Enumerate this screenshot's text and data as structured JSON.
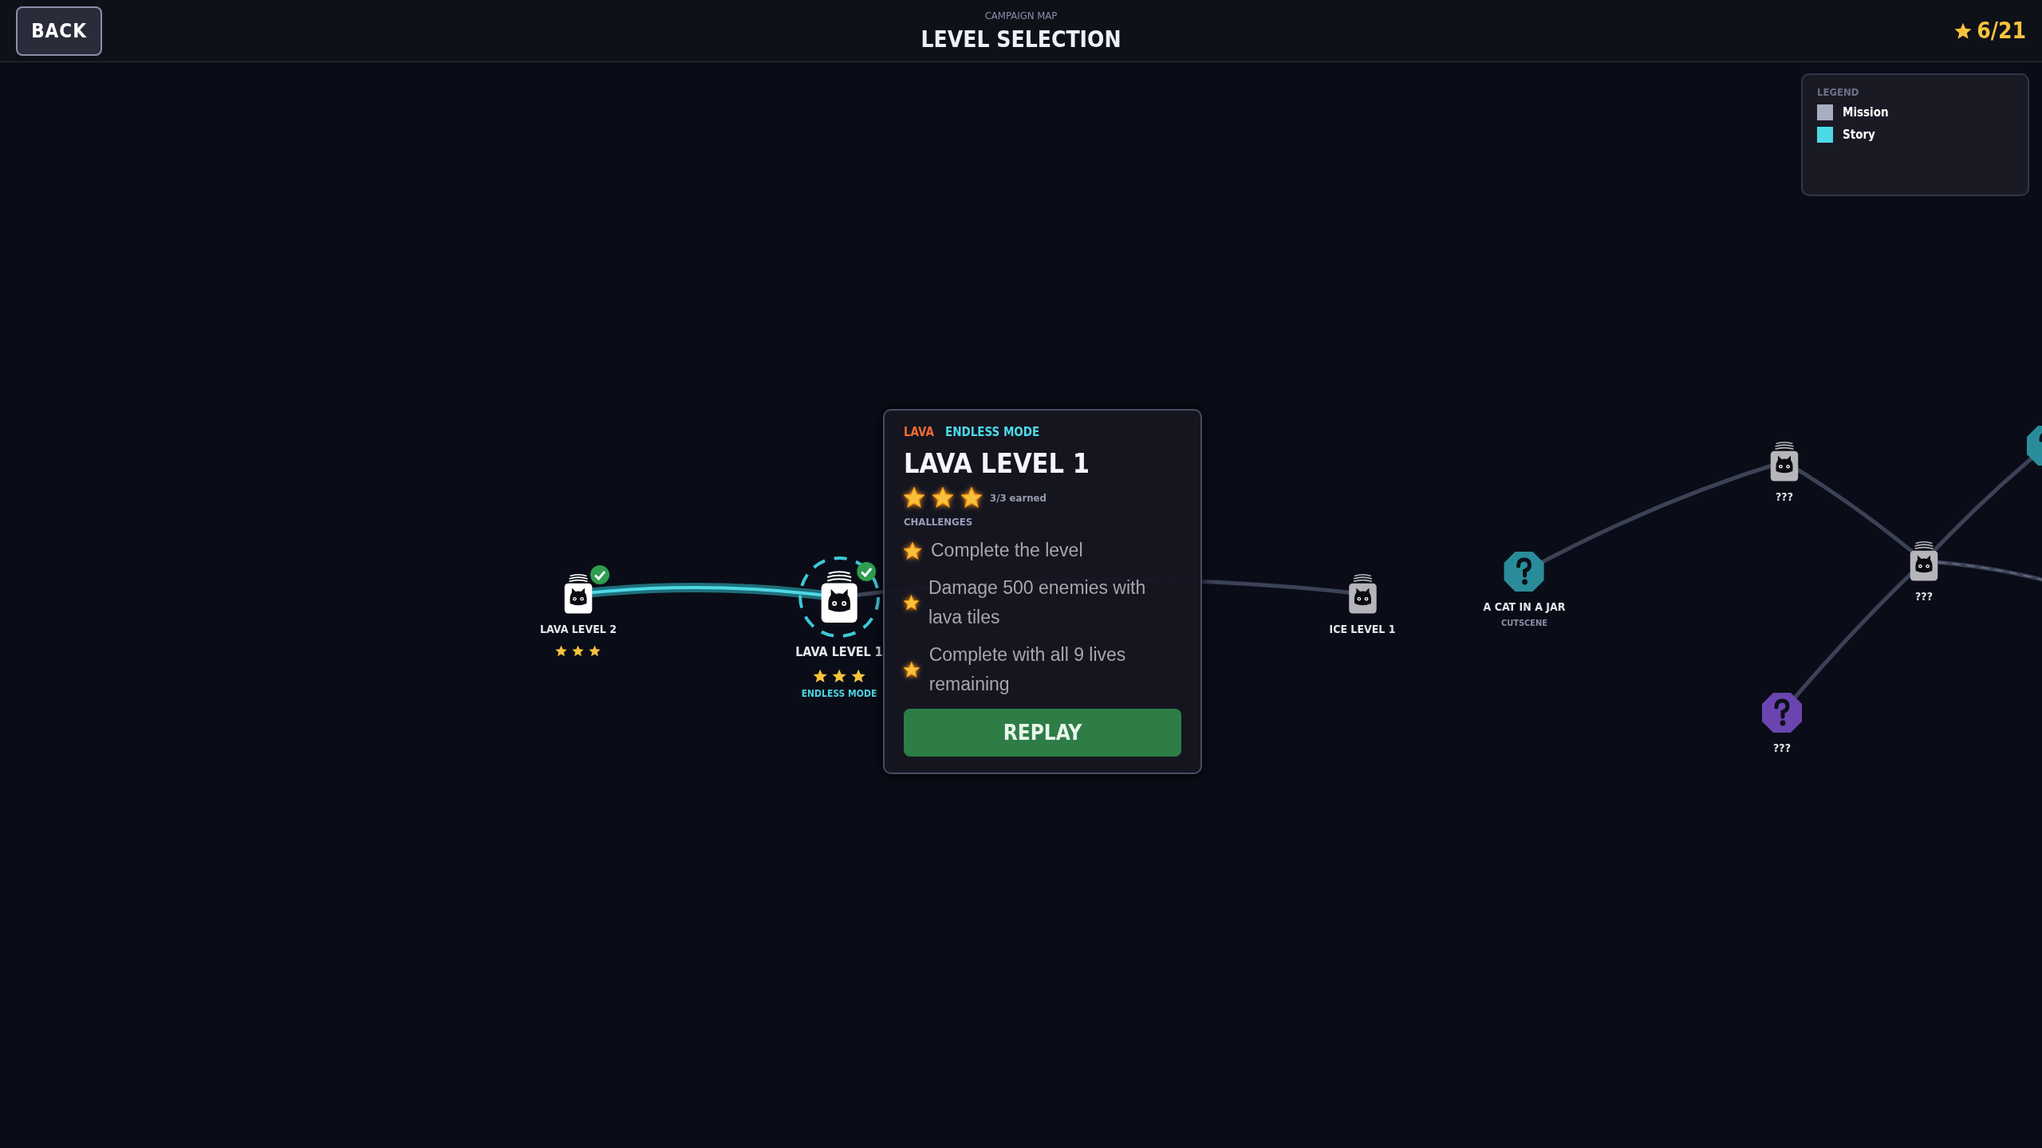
{
  "top_bar": {
    "back_button": "BACK",
    "subtitle": "CAMPAIGN MAP",
    "title": "LEVEL SELECTION",
    "star_total": "6/21"
  },
  "legend": {
    "title": "LEGEND",
    "items": [
      {
        "label": "Mission",
        "color": "#a9adc1"
      },
      {
        "label": "Story",
        "color": "#4dd9e6"
      }
    ]
  },
  "nodes": [
    {
      "kind": "mission",
      "label": "LAVA LEVEL 2",
      "completed": true,
      "selected": false,
      "locked": false,
      "stars": 3
    },
    {
      "kind": "mission",
      "label": "LAVA LEVEL 1",
      "completed": true,
      "selected": true,
      "locked": false,
      "stars": 3,
      "tag": "ENDLESS MODE"
    },
    {
      "kind": "mission",
      "label": "ICE LEVEL 1",
      "completed": false,
      "selected": false,
      "locked": true
    },
    {
      "kind": "story",
      "label": "A CAT IN A JAR",
      "sublabel": "CUTSCENE"
    },
    {
      "kind": "mission",
      "label": "???",
      "completed": false,
      "selected": false,
      "locked": true
    },
    {
      "kind": "mission",
      "label": "???",
      "completed": false,
      "selected": false,
      "locked": true
    },
    {
      "kind": "secret",
      "label": "???"
    },
    {
      "kind": "story"
    }
  ],
  "popup": {
    "region": "LAVA",
    "mode": "ENDLESS MODE",
    "title": "LAVA LEVEL 1",
    "stars": 3,
    "stars_text": "3/3 earned",
    "challenges_heading": "CHALLENGES",
    "challenges": [
      {
        "text": "Complete the level",
        "done": true
      },
      {
        "text": "Damage 500 enemies with lava tiles",
        "done": true
      },
      {
        "text": "Complete with all 9 lives remaining",
        "done": true
      }
    ],
    "button": "REPLAY"
  }
}
